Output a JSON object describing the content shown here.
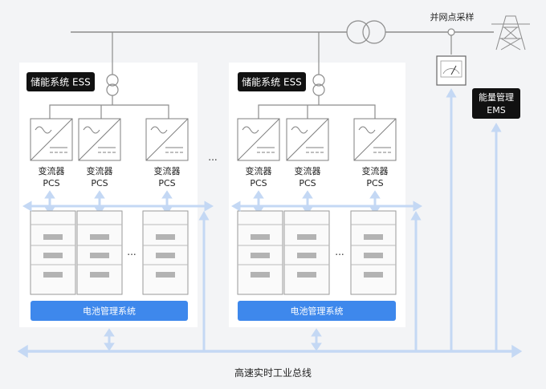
{
  "grid_label": "并网点采样",
  "ems": {
    "line1": "能量管理",
    "line2": "EMS"
  },
  "bus_label": "高速实时工业总线",
  "ellipsis": "...",
  "ess_units": [
    {
      "title": "储能系统 ESS",
      "pcs": [
        {
          "line1": "变流器",
          "line2": "PCS"
        },
        {
          "line1": "变流器",
          "line2": "PCS"
        },
        {
          "line1": "变流器",
          "line2": "PCS"
        }
      ],
      "bms_label": "电池管理系统"
    },
    {
      "title": "储能系统 ESS",
      "pcs": [
        {
          "line1": "变流器",
          "line2": "PCS"
        },
        {
          "line1": "变流器",
          "line2": "PCS"
        },
        {
          "line1": "变流器",
          "line2": "PCS"
        }
      ],
      "bms_label": "电池管理系统"
    }
  ],
  "colors": {
    "arrow": "#c4d8f4",
    "accent_blue": "#3e88ec",
    "label_bg": "#111111",
    "line": "#8c8c8c",
    "pack": "#b3b3b3"
  }
}
